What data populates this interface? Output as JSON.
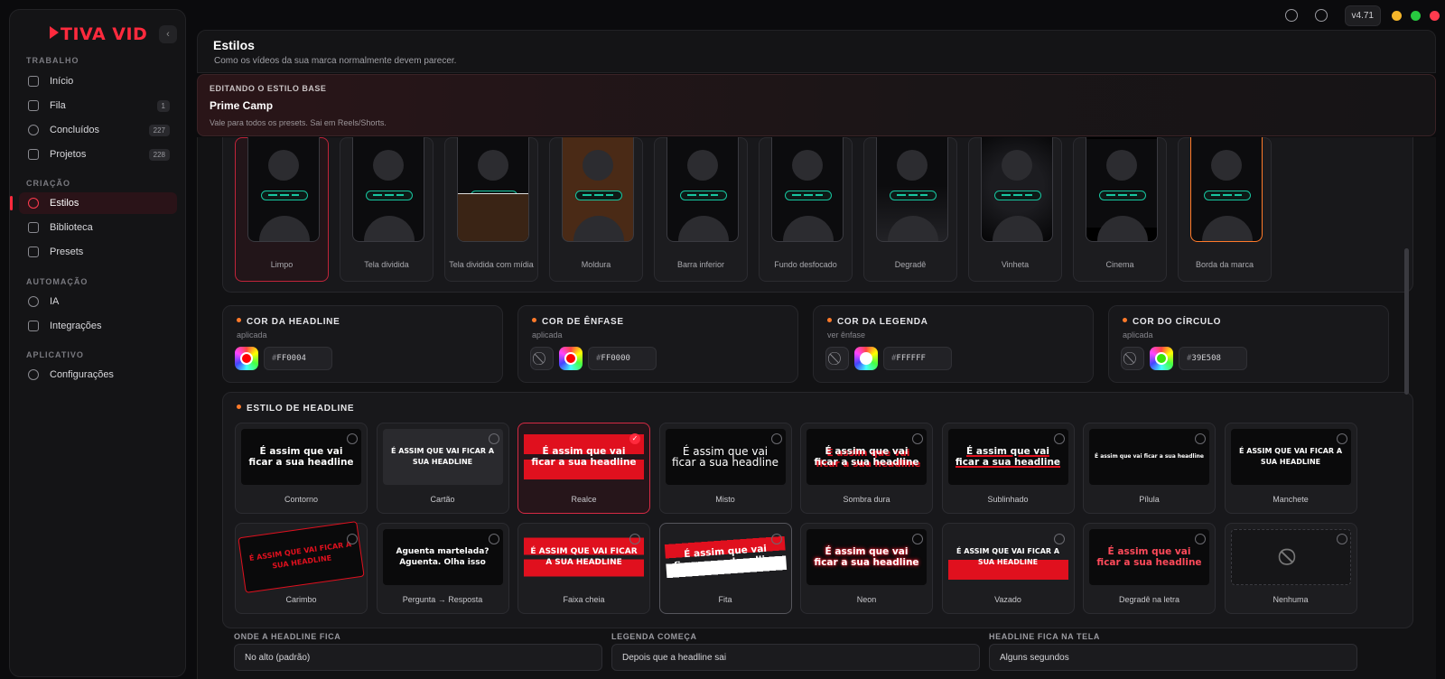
{
  "sidebar": {
    "logo": "TIVA VID",
    "sections": [
      {
        "label": "TRABALHO",
        "items": [
          {
            "label": "Início"
          },
          {
            "label": "Fila",
            "badge": "1"
          },
          {
            "label": "Concluídos",
            "badge": "227"
          },
          {
            "label": "Projetos",
            "badge": "228"
          }
        ]
      },
      {
        "label": "CRIAÇÃO",
        "items": [
          {
            "label": "Estilos"
          },
          {
            "label": "Biblioteca"
          },
          {
            "label": "Presets"
          }
        ]
      },
      {
        "label": "AUTOMAÇÃO",
        "items": [
          {
            "label": "IA"
          },
          {
            "label": "Integrações"
          }
        ]
      },
      {
        "label": "APLICATIVO",
        "items": [
          {
            "label": "Configurações"
          }
        ]
      }
    ]
  },
  "topbar": {
    "version": "v4.71",
    "window_colors": [
      "#f4b52a",
      "#28c840",
      "#ff3b4e"
    ]
  },
  "header": {
    "title": "Estilos",
    "subtitle": "Como os vídeos da sua marca normalmente devem parecer."
  },
  "banner": {
    "kicker": "EDITANDO O ESTILO BASE",
    "title": "Prime Camp",
    "subtitle": "Vale para todos os presets. Sai em Reels/Shorts."
  },
  "layouts": [
    "Limpo",
    "Tela dividida",
    "Tela dividida com mídia",
    "Moldura",
    "Barra inferior",
    "Fundo desfocado",
    "Degradê",
    "Vinheta",
    "Cinema",
    "Borda da marca"
  ],
  "colors": [
    {
      "title": "COR DA HEADLINE",
      "sub": "aplicada",
      "hex": "FF0004",
      "swatch": "#FF0004",
      "none_btn": false
    },
    {
      "title": "COR DE ÊNFASE",
      "sub": "aplicada",
      "hex": "FF0000",
      "swatch": "#FF0000",
      "none_btn": true
    },
    {
      "title": "COR DA LEGENDA",
      "sub": "ver ênfase",
      "hex": "FFFFFF",
      "swatch": "#FFFFFF",
      "none_btn": true
    },
    {
      "title": "COR DO CÍRCULO",
      "sub": "aplicada",
      "hex": "39E508",
      "swatch": "#39E508",
      "none_btn": true
    }
  ],
  "headline_style": {
    "title": "ESTILO DE HEADLINE",
    "options": [
      {
        "label": "Contorno",
        "preview": "É assim que vai ficar a sua headline"
      },
      {
        "label": "Cartão",
        "preview": "É ASSIM QUE VAI FICAR A SUA HEADLINE"
      },
      {
        "label": "Realce",
        "preview": "É assim que vai ficar a sua headline",
        "selected": true
      },
      {
        "label": "Misto",
        "preview": "É assim que vai ficar a sua headline"
      },
      {
        "label": "Sombra dura",
        "preview": "É assim que vai ficar a sua headline"
      },
      {
        "label": "Sublinhado",
        "preview": "É assim que vai ficar a sua headline"
      },
      {
        "label": "Pílula",
        "preview": "É assim que vai ficar a sua headline"
      },
      {
        "label": "Manchete",
        "preview": "É ASSIM QUE VAI FICAR A SUA HEADLINE"
      },
      {
        "label": "Carimbo",
        "preview": "É ASSIM QUE VAI FICAR A SUA HEADLINE"
      },
      {
        "label": "Pergunta → Resposta",
        "preview": "Aguenta martelada? Aguenta. Olha isso"
      },
      {
        "label": "Faixa cheia",
        "preview": "É ASSIM QUE VAI FICAR A SUA HEADLINE"
      },
      {
        "label": "Fita",
        "preview": "É assim que vai ficar a sua headline"
      },
      {
        "label": "Neon",
        "preview": "É assim que vai ficar a sua headline"
      },
      {
        "label": "Vazado",
        "preview": "É ASSIM QUE VAI FICAR A SUA HEADLINE"
      },
      {
        "label": "Degradê na letra",
        "preview": "É assim que vai ficar a sua headline"
      },
      {
        "label": "Nenhuma",
        "preview": "⃠"
      }
    ]
  },
  "selects": [
    {
      "label": "ONDE A HEADLINE FICA",
      "value": "No alto (padrão)"
    },
    {
      "label": "LEGENDA COMEÇA",
      "value": "Depois que a headline sai"
    },
    {
      "label": "HEADLINE FICA NA TELA",
      "value": "Alguns segundos"
    }
  ]
}
